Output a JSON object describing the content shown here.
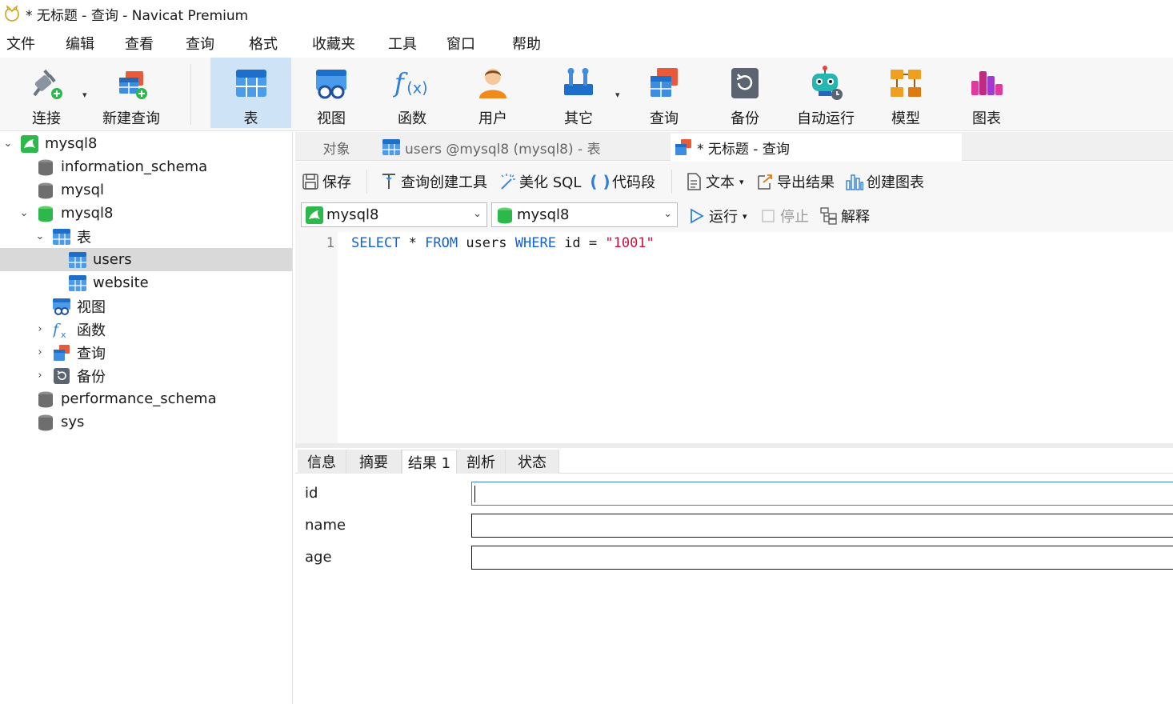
{
  "window": {
    "title": "* 无标题 - 查询 - Navicat Premium"
  },
  "menu": [
    "文件",
    "编辑",
    "查看",
    "查询",
    "格式",
    "收藏夹",
    "工具",
    "窗口",
    "帮助"
  ],
  "toolbar": {
    "connect": "连接",
    "new_query": "新建查询",
    "table": "表",
    "view": "视图",
    "function": "函数",
    "user": "用户",
    "other": "其它",
    "query": "查询",
    "backup": "备份",
    "automation": "自动运行",
    "model": "模型",
    "chart": "图表"
  },
  "tree": {
    "connection": "mysql8",
    "db_information_schema": "information_schema",
    "db_mysql": "mysql",
    "db_mysql8": "mysql8",
    "tables_group": "表",
    "table_users": "users",
    "table_website": "website",
    "views_group": "视图",
    "functions_group": "函数",
    "queries_group": "查询",
    "backups_group": "备份",
    "db_performance_schema": "performance_schema",
    "db_sys": "sys"
  },
  "tabs": {
    "objects": "对象",
    "users_table": "users @mysql8 (mysql8) - 表",
    "query": "* 无标题 - 查询"
  },
  "query_toolbar": {
    "save": "保存",
    "query_builder": "查询创建工具",
    "beautify": "美化 SQL",
    "snippet": "代码段",
    "text": "文本",
    "export": "导出结果",
    "create_chart": "创建图表"
  },
  "db_bar": {
    "connection": "mysql8",
    "database": "mysql8",
    "run": "运行",
    "stop": "停止",
    "explain": "解释"
  },
  "editor": {
    "line_number": "1",
    "tokens": {
      "select": "SELECT",
      "star": " * ",
      "from": "FROM",
      "table": " users ",
      "where": "WHERE",
      "cond": " id = ",
      "value": "\"1001\""
    }
  },
  "result_tabs": [
    "信息",
    "摘要",
    "结果 1",
    "剖析",
    "状态"
  ],
  "result_fields": [
    "id",
    "name",
    "age"
  ],
  "colors": {
    "accent_blue": "#1560d4",
    "string_red": "#d0103a",
    "mysql_green": "#2db84c",
    "selection_gray": "#d9d9d9"
  }
}
